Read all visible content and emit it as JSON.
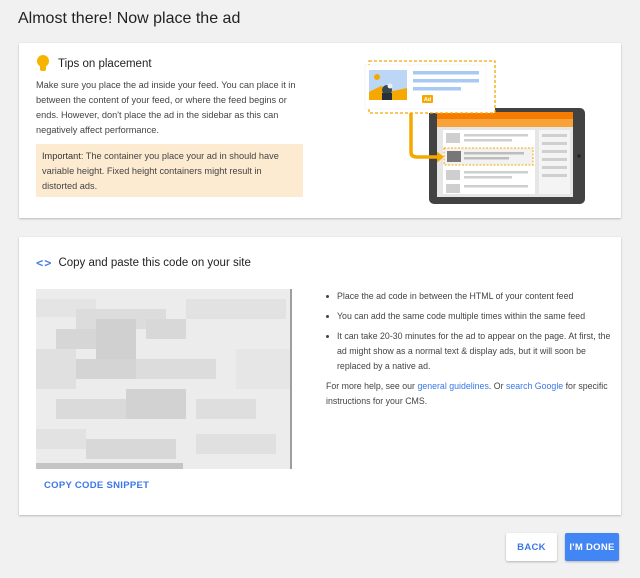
{
  "page": {
    "title": "Almost there! Now place the ad"
  },
  "tips": {
    "title": "Tips on placement",
    "body": "Make sure you place the ad inside your feed. You can place it in between the content of your feed, or where the feed begins or ends. However, don't place the ad in the sidebar as this can negatively affect performance.",
    "important_label": "Important",
    "important_text": ": The container you place your ad in should have variable height. Fixed height containers might result in distorted ads.",
    "icon": "lightbulb-icon"
  },
  "code": {
    "icon": "code-brackets-icon",
    "title": "Copy and paste this code on your site",
    "copy_label": "COPY CODE SNIPPET"
  },
  "info": {
    "bullets": [
      "Place the ad code in between the HTML of your content feed",
      "You can add the same code multiple times within the same feed",
      "It can take 20-30 minutes for the ad to appear on the page. At first, the ad might show as a normal text & display ads, but it will soon be replaced by a native ad."
    ],
    "help_prefix": "For more help, see our ",
    "help_link1": "general guidelines",
    "help_middle": ". Or ",
    "help_link2": "search Google",
    "help_suffix": " for specific instructions for your CMS."
  },
  "buttons": {
    "back": "BACK",
    "done": "I'M DONE"
  },
  "illustration": {
    "ad_badge": "Ad"
  },
  "colors": {
    "accent": "#4285f4",
    "link": "#3b78e7",
    "orange": "#f6a800",
    "important_bg": "#fcebd1"
  }
}
